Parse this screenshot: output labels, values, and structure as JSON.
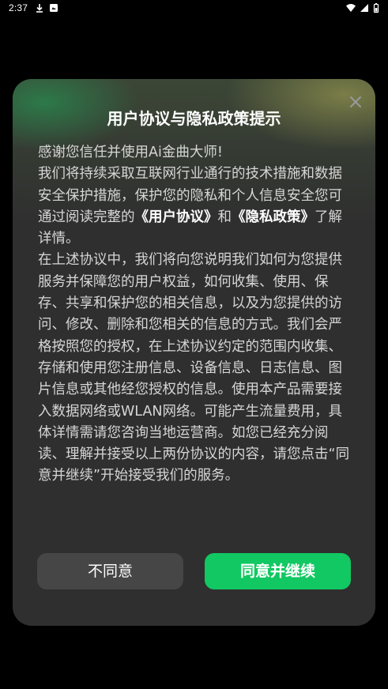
{
  "status_bar": {
    "time": "2:37",
    "icons": [
      "download-icon",
      "notification-icon",
      "wifi-icon",
      "signal-icon",
      "battery-icon"
    ]
  },
  "dialog": {
    "title": "用户协议与隐私政策提示",
    "close_icon": "close-icon",
    "greeting": "感谢您信任并使用Ai金曲大师!",
    "para1_before": "我们将持续采取互联网行业通行的技术措施和数据安全保护措施，保护您的隐私和个人信息安全您可通过阅读完整的",
    "user_agreement_link": "《用户协议》",
    "and_text": "和",
    "privacy_policy_link": "《隐私政策》",
    "para1_after": "了解详情。",
    "para2": "在上述协议中，我们将向您说明我们如何为您提供服务并保障您的用户权益，如何收集、使用、保存、共享和保护您的相关信息，以及为您提供的访问、修改、删除和您相关的信息的方式。我们会严格按照您的授权，在上述协议约定的范围内收集、存储和使用您注册信息、设备信息、日志信息、图片信息或其他经您授权的信息。使用本产品需要接入数据网络或WLAN网络。可能产生流量费用，具体详情需请您咨询当地运营商。如您已经充分阅读、理解并接受以上两份协议的内容，请您点击“同意并继续”开始接受我们的服务。",
    "decline_label": "不同意",
    "accept_label": "同意并继续"
  },
  "colors": {
    "background": "#000000",
    "dialog_bg": "#2f2f2f",
    "accept_button": "#12c862",
    "decline_button": "#464646"
  }
}
